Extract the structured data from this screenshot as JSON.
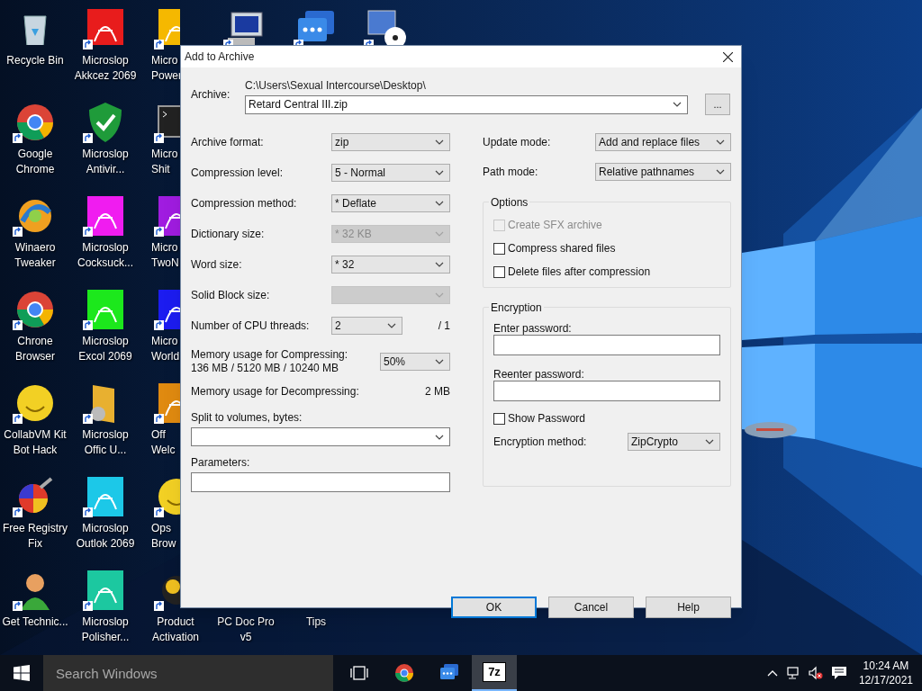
{
  "desktop_rows": [
    [
      {
        "label": "Recycle Bin",
        "kind": "recycle",
        "shortcut": false
      },
      {
        "label": "Microslop Akkcez 2069",
        "kind": "tile",
        "color": "#e81c1c",
        "shortcut": true
      },
      {
        "label": "Micro Power",
        "kind": "tile",
        "color": "#f5b800",
        "shortcut": true,
        "cut_off": true
      },
      {
        "kind": "computer",
        "shortcut": true
      },
      {
        "kind": "chat",
        "shortcut": true
      },
      {
        "kind": "monitor_disc",
        "shortcut": true
      }
    ],
    [
      {
        "label": "Google Chrome",
        "kind": "chrome",
        "shortcut": true
      },
      {
        "label": "Microslop Antivir...",
        "kind": "shield",
        "shortcut": true
      },
      {
        "label": "Micro Shit",
        "kind": "terminal",
        "shortcut": true,
        "cut_off": true
      }
    ],
    [
      {
        "label": "Winaero Tweaker",
        "kind": "swirl",
        "shortcut": true
      },
      {
        "label": "Microslop Cocksuck...",
        "kind": "tile",
        "color": "#f01cf0",
        "shortcut": true
      },
      {
        "label": "Micro TwoN",
        "kind": "tile",
        "color": "#a01ce0",
        "shortcut": true,
        "cut_off": true
      }
    ],
    [
      {
        "label": "Chrone Browser",
        "kind": "chrome",
        "shortcut": true
      },
      {
        "label": "Microslop Excol 2069",
        "kind": "tile",
        "color": "#1ce81c",
        "shortcut": true
      },
      {
        "label": "Micro World",
        "kind": "tile",
        "color": "#1c1cf0",
        "shortcut": true,
        "cut_off": true
      }
    ],
    [
      {
        "label": "CollabVM Kit Bot Hack",
        "kind": "smiley",
        "shortcut": true
      },
      {
        "label": "Microslop Offic U...",
        "kind": "folder",
        "shortcut": true
      },
      {
        "label": "Off Welc",
        "kind": "tile",
        "color": "#e08a10",
        "shortcut": true,
        "cut_off": true
      }
    ],
    [
      {
        "label": "Free Registry Fix",
        "kind": "gear",
        "shortcut": true
      },
      {
        "label": "Microslop Outlok 2069",
        "kind": "tile",
        "color": "#1cc8e8",
        "shortcut": true
      },
      {
        "label": "Ops Brow",
        "kind": "smiley",
        "shortcut": true,
        "cut_off": true
      }
    ],
    [
      {
        "label": "Get Technic...",
        "kind": "person",
        "shortcut": true
      },
      {
        "label": "Microslop Polisher...",
        "kind": "tile",
        "color": "#1cc8a0",
        "shortcut": true
      },
      {
        "label": "Product Activation",
        "kind": "disc",
        "shortcut": true
      },
      {
        "label": "PC Doc Pro v5",
        "kind": "hidden"
      },
      {
        "label": "Tips",
        "kind": "hidden"
      }
    ]
  ],
  "dialog": {
    "title": "Add to Archive",
    "archive": {
      "label": "Archive:",
      "path": "C:\\Users\\Sexual Intercourse\\Desktop\\",
      "value": "Retard Central III.zip",
      "browse": "..."
    },
    "left_fields": [
      {
        "kind": "select",
        "label": "Archive format:",
        "value": "zip",
        "disabled": false
      },
      {
        "kind": "select",
        "label": "Compression level:",
        "value": "5 - Normal",
        "disabled": false
      },
      {
        "kind": "select",
        "label": "Compression method:",
        "value": "* Deflate",
        "disabled": false
      },
      {
        "kind": "select",
        "label": "Dictionary size:",
        "value": "* 32 KB",
        "disabled": true
      },
      {
        "kind": "select",
        "label": "Word size:",
        "value": "* 32",
        "disabled": false
      },
      {
        "kind": "select",
        "label": "Solid Block size:",
        "disabled": true
      },
      {
        "kind": "threads",
        "label": "Number of CPU threads:",
        "value": "2",
        "suffix": "/ 1",
        "disabled": false
      },
      {
        "kind": "memory_select",
        "label": "Memory usage for Compressing:",
        "reading": "136 MB / 5120 MB / 10240 MB",
        "value": "50%",
        "disabled": false
      },
      {
        "kind": "memory_value",
        "label": "Memory usage for Decompressing:",
        "value": "2 MB"
      },
      {
        "kind": "combo_stacked",
        "label": "Split to volumes, bytes:"
      },
      {
        "kind": "input_stacked",
        "label": "Parameters:"
      }
    ],
    "update_mode": {
      "label": "Update mode:",
      "value": "Add and replace files"
    },
    "path_mode": {
      "label": "Path mode:",
      "value": "Relative pathnames"
    },
    "options": {
      "title": "Options",
      "checkboxes": [
        {
          "label": "Create SFX archive",
          "checked": false,
          "disabled": true
        },
        {
          "label": "Compress shared files",
          "checked": false,
          "disabled": false
        },
        {
          "label": "Delete files after compression",
          "checked": false,
          "disabled": false
        }
      ]
    },
    "encryption": {
      "title": "Encryption",
      "enter_label": "Enter password:",
      "reenter_label": "Reenter password:",
      "show_password": {
        "label": "Show Password",
        "checked": false
      },
      "method": {
        "label": "Encryption method:",
        "value": "ZipCrypto"
      }
    },
    "buttons": [
      {
        "label": "OK",
        "default": true
      },
      {
        "label": "Cancel",
        "default": false
      },
      {
        "label": "Help",
        "default": false
      }
    ]
  },
  "taskbar": {
    "search": {
      "placeholder": "Search Windows"
    },
    "apps": [
      {
        "kind": "taskview",
        "selected": false
      },
      {
        "kind": "chrome",
        "selected": false
      },
      {
        "kind": "chat",
        "selected": false
      },
      {
        "kind": "sevenzip",
        "label": "7z",
        "selected": true
      }
    ],
    "time": "10:24 AM",
    "date": "12/17/2021"
  }
}
